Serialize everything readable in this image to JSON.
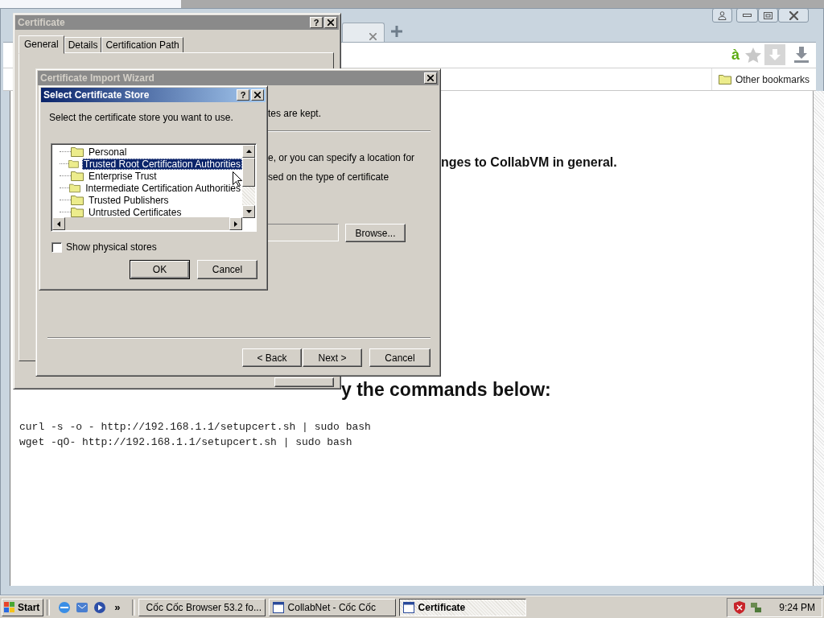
{
  "browser": {
    "extension_label": "à",
    "bookmarks": [
      {
        "label": "Other bookmarks"
      }
    ],
    "page": {
      "line_1": "nges to CollabVM in general.",
      "heading": "y the commands below:",
      "commands": [
        "curl -s -o - http://192.168.1.1/setupcert.sh | sudo bash",
        "wget -qO- http://192.168.1.1/setupcert.sh | sudo bash"
      ]
    }
  },
  "certificate_window": {
    "title": "Certificate",
    "help": "?",
    "tabs": [
      {
        "label": "General",
        "selected": true
      },
      {
        "label": "Details",
        "selected": false
      },
      {
        "label": "Certification Path",
        "selected": false
      }
    ]
  },
  "import_wizard": {
    "title": "Certificate Import Wizard",
    "text_fragments": [
      "tes are kept.",
      "e, or you can specify a location for",
      "sed on the type of certificate"
    ],
    "browse_button": "Browse...",
    "buttons": [
      "< Back",
      "Next >",
      "Cancel"
    ]
  },
  "store_dialog": {
    "title": "Select Certificate Store",
    "help": "?",
    "prompt": "Select the certificate store you want to use.",
    "stores": [
      {
        "label": "Personal",
        "selected": false
      },
      {
        "label": "Trusted Root Certification Authorities",
        "selected": true
      },
      {
        "label": "Enterprise Trust",
        "selected": false
      },
      {
        "label": "Intermediate Certification Authorities",
        "selected": false
      },
      {
        "label": "Trusted Publishers",
        "selected": false
      },
      {
        "label": "Untrusted Certificates",
        "selected": false
      }
    ],
    "show_physical_stores": {
      "label": "Show physical stores",
      "checked": false
    },
    "buttons": [
      "OK",
      "Cancel"
    ]
  },
  "taskbar": {
    "start": "Start",
    "overflow": "»",
    "tasks": [
      {
        "label": "Cốc Cốc Browser 53.2 fo...",
        "selected": false
      },
      {
        "label": "CollabNet - Cốc Cốc",
        "selected": false
      },
      {
        "label": "Certificate",
        "selected": true
      }
    ],
    "clock": "9:24 PM"
  }
}
